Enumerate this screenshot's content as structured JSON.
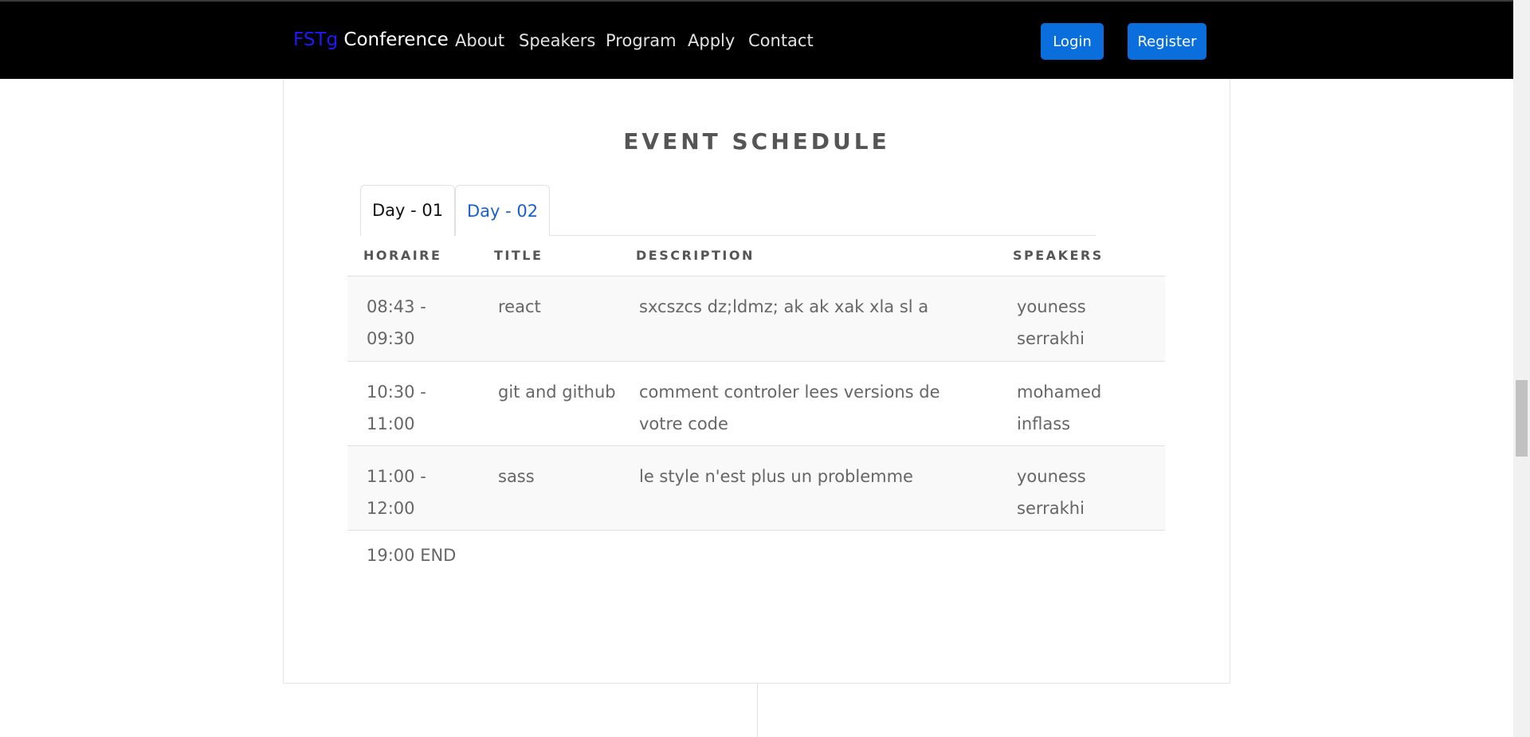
{
  "navbar": {
    "brand_accent": "FSTg",
    "brand_name": "Conference",
    "links": [
      "About",
      "Speakers",
      "Program",
      "Apply",
      "Contact"
    ],
    "login_label": "Login",
    "register_label": "Register"
  },
  "schedule": {
    "title": "EVENT SCHEDULE",
    "tabs": [
      {
        "label": "Day - 01",
        "active": true
      },
      {
        "label": "Day - 02",
        "active": false
      }
    ],
    "columns": [
      "HORAIRE",
      "TITLE",
      "DESCRIPTION",
      "SPEAKERS"
    ],
    "rows": [
      {
        "time": "08:43 - 09:30",
        "title": "react",
        "description": "sxcszcs dz;ldmz; ak ak xak xla sl a",
        "speakers": "youness serrakhi"
      },
      {
        "time": "10:30 - 11:00",
        "title": "git and github",
        "description": "comment controler lees versions de votre code",
        "speakers": "mohamed inflass"
      },
      {
        "time": "11:00 - 12:00",
        "title": "sass",
        "description": "le style n'est plus un problemme",
        "speakers": "youness serrakhi"
      }
    ],
    "end_label": "19:00 END"
  },
  "colors": {
    "navbar_bg": "#000000",
    "brand_accent": "#1a1aff",
    "button_bg": "#0a6fdd",
    "tab_link": "#1a5fd0"
  }
}
